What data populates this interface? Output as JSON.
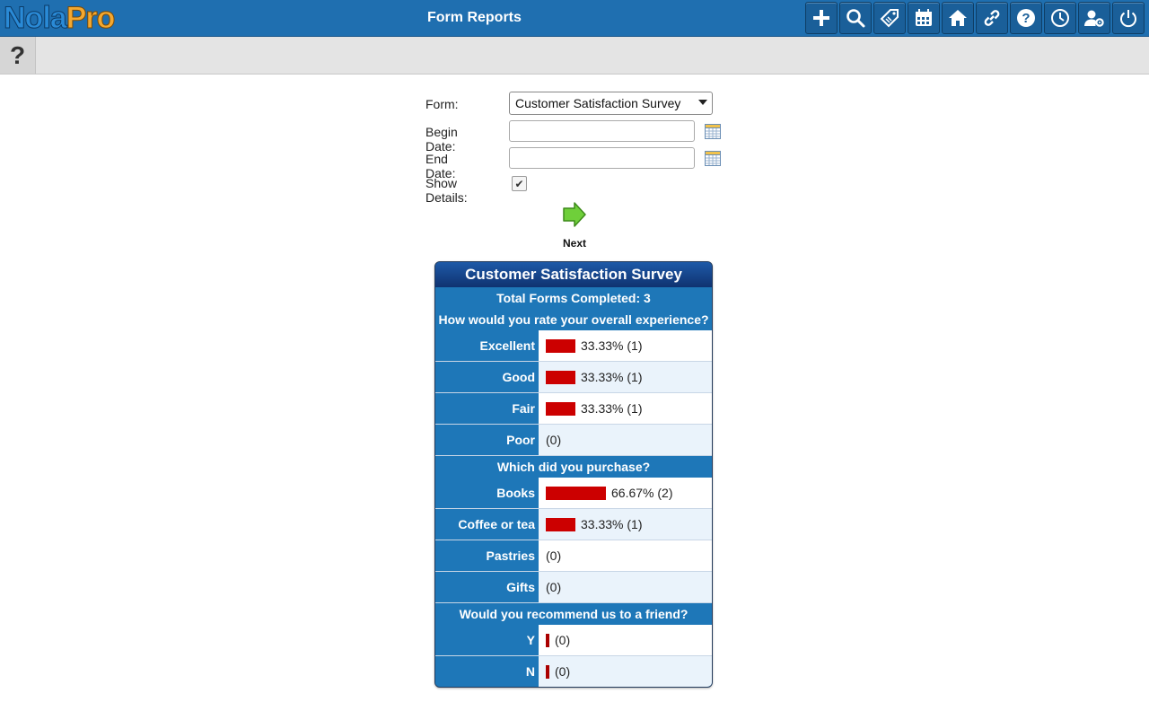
{
  "app": {
    "logo_part1": "Nola",
    "logo_part2": "Pro",
    "title": "Form Reports"
  },
  "toolbar": [
    {
      "name": "add-icon"
    },
    {
      "name": "search-icon"
    },
    {
      "name": "tag-icon"
    },
    {
      "name": "calendar-icon"
    },
    {
      "name": "home-icon"
    },
    {
      "name": "link-icon"
    },
    {
      "name": "help-icon"
    },
    {
      "name": "clock-icon"
    },
    {
      "name": "user-settings-icon"
    },
    {
      "name": "power-icon"
    }
  ],
  "subbar": {
    "help": "?"
  },
  "form": {
    "form_label": "Form:",
    "form_value": "Customer Satisfaction Survey",
    "begin_label": "Begin Date:",
    "begin_value": "",
    "end_label": "End Date:",
    "end_value": "",
    "details_label": "Show Details:",
    "details_checked": true,
    "next_label": "Next"
  },
  "report": {
    "title": "Customer Satisfaction Survey",
    "total": "Total Forms Completed: 3",
    "questions": [
      {
        "question": "How would you rate your overall experience?",
        "answers": [
          {
            "label": "Excellent",
            "text": "33.33% (1)",
            "fraction": 0.3333
          },
          {
            "label": "Good",
            "text": "33.33% (1)",
            "fraction": 0.3333
          },
          {
            "label": "Fair",
            "text": "33.33% (1)",
            "fraction": 0.3333
          },
          {
            "label": "Poor",
            "text": "(0)",
            "fraction": 0
          }
        ]
      },
      {
        "question": "Which did you purchase?",
        "answers": [
          {
            "label": "Books",
            "text": "66.67% (2)",
            "fraction": 0.6667
          },
          {
            "label": "Coffee or tea",
            "text": "33.33% (1)",
            "fraction": 0.3333
          },
          {
            "label": "Pastries",
            "text": "(0)",
            "fraction": 0
          },
          {
            "label": "Gifts",
            "text": "(0)",
            "fraction": 0
          }
        ]
      },
      {
        "question": "Would you recommend us to a friend?",
        "answers": [
          {
            "label": "Y",
            "text": "(0)",
            "fraction": 0,
            "stub": true
          },
          {
            "label": "N",
            "text": "(0)",
            "fraction": 0,
            "stub": true
          }
        ]
      }
    ]
  }
}
